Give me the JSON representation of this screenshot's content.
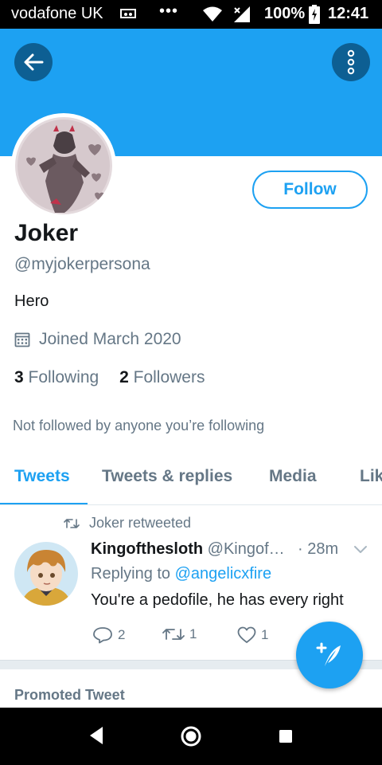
{
  "status_bar": {
    "carrier": "vodafone UK",
    "dots": "•••",
    "battery_percent": "100%",
    "time": "12:41"
  },
  "profile": {
    "display_name": "Joker",
    "handle": "@myjokerpersona",
    "bio": "Hero",
    "joined": "Joined March 2020",
    "following_count": "3",
    "following_label": "Following",
    "followers_count": "2",
    "followers_label": "Followers",
    "follow_button": "Follow",
    "not_followed_text": "Not followed by anyone you’re following"
  },
  "tabs": [
    {
      "label": "Tweets",
      "active": true
    },
    {
      "label": "Tweets & replies",
      "active": false
    },
    {
      "label": "Media",
      "active": false
    },
    {
      "label": "Lik",
      "active": false
    }
  ],
  "tweet": {
    "retweet_label": "Joker retweeted",
    "author": "Kingofthesloth",
    "author_handle": "@Kingof…",
    "time": "· 28m",
    "replying_prefix": "Replying to",
    "replying_to": "@angelicxfire",
    "text": "You're a pedofile, he has every right",
    "reply_count": "2",
    "retweet_count": "1",
    "like_count": "1"
  },
  "promoted_label": "Promoted Tweet",
  "colors": {
    "accent": "#1da1f2",
    "header_button": "#0d5f93",
    "secondary_text": "#657786"
  },
  "icons": [
    "back-arrow-icon",
    "more-vertical-icon",
    "calendar-icon",
    "retweet-icon",
    "chevron-down-icon",
    "reply-icon",
    "like-icon",
    "compose-tweet-icon"
  ]
}
